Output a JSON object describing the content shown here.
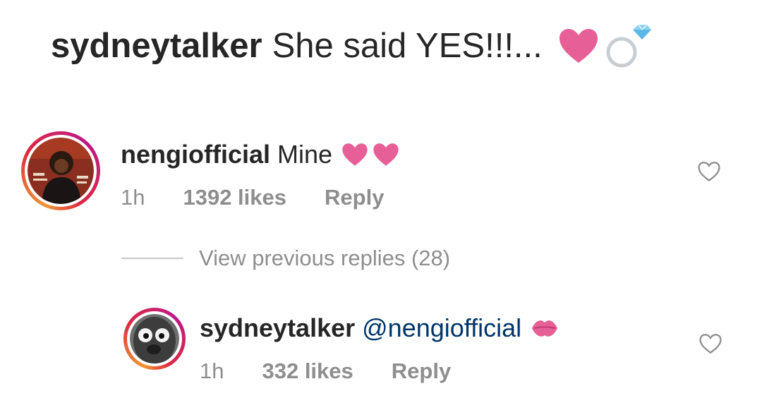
{
  "post": {
    "username": "sydneytalker",
    "caption": "She said YES!!!...",
    "emojis": [
      "heart",
      "ring"
    ]
  },
  "comments": [
    {
      "username": "nengiofficial",
      "text": "Mine",
      "emojis": [
        "heart",
        "heart"
      ],
      "time": "1h",
      "likes": "1392 likes",
      "reply": "Reply"
    }
  ],
  "view_previous": "View previous replies (28)",
  "replies": [
    {
      "username": "sydneytalker",
      "mention": "@nengiofficial",
      "emoji": "kiss-mark",
      "time": "1h",
      "likes": "332 likes",
      "reply": "Reply"
    }
  ],
  "colors": {
    "heart": "#e75f97",
    "meta": "#8e8e8e",
    "mention": "#003569",
    "text": "#262626"
  }
}
